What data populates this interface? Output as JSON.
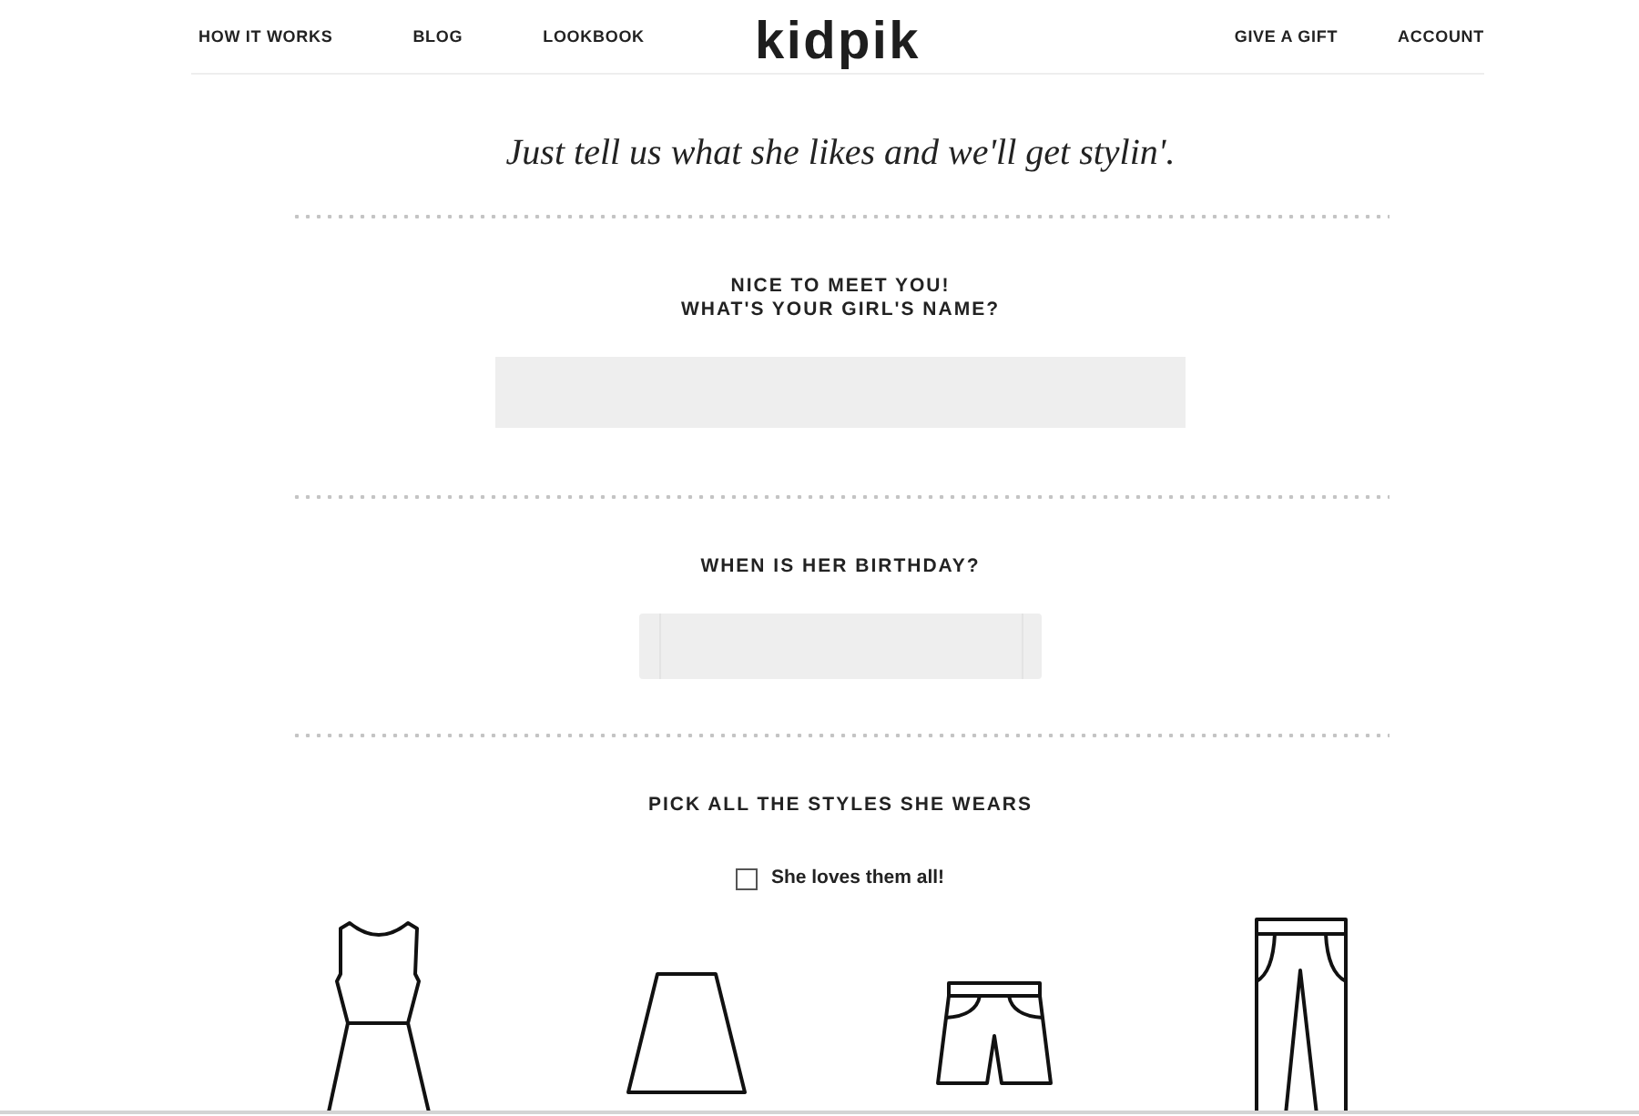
{
  "nav": {
    "left_links": [
      {
        "label": "HOW IT WORKS"
      },
      {
        "label": "BLOG"
      },
      {
        "label": "LOOKBOOK"
      }
    ],
    "logo": "kidpik",
    "right_links": [
      {
        "label": "GIVE A GIFT"
      },
      {
        "label": "ACCOUNT"
      }
    ]
  },
  "tagline": "Just tell us what she likes and we'll get stylin'.",
  "sections": [
    {
      "kind": "text_field",
      "heading": "NICE TO MEET YOU!\nWHAT'S YOUR GIRL'S NAME?"
    },
    {
      "kind": "date_field",
      "heading": "WHEN IS HER BIRTHDAY?"
    },
    {
      "kind": "styles",
      "heading": "PICK ALL THE STYLES SHE WEARS",
      "select_all": {
        "label": "She loves them all!",
        "checked": false
      },
      "styles": [
        {
          "kind": "dress"
        },
        {
          "kind": "skirt"
        },
        {
          "kind": "shorts"
        },
        {
          "kind": "pants"
        }
      ]
    }
  ]
}
